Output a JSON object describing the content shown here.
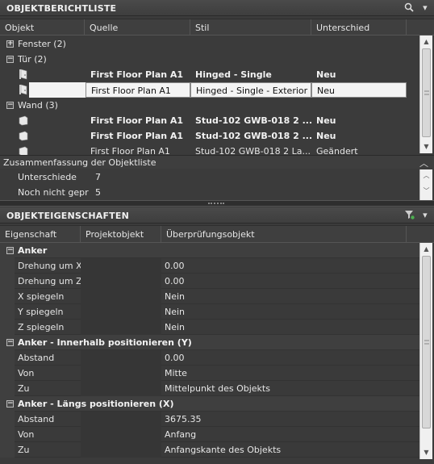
{
  "object_report": {
    "title": "OBJEKTBERICHTLISTE",
    "columns": [
      "Objekt",
      "Quelle",
      "Stil",
      "Unterschied"
    ],
    "groups": [
      {
        "label": "Fenster (2)",
        "expanded": false,
        "rows": []
      },
      {
        "label": "Tür (2)",
        "expanded": true,
        "rows": [
          {
            "quelle": "First Floor Plan A1",
            "stil": "Hinged - Single",
            "unterschied": "Neu",
            "bold": true,
            "selected": false,
            "icon": "door-icon"
          },
          {
            "quelle": "First Floor Plan A1",
            "stil": "Hinged - Single - Exterior",
            "unterschied": "Neu",
            "bold": false,
            "selected": true,
            "icon": "door-icon"
          }
        ]
      },
      {
        "label": "Wand (3)",
        "expanded": true,
        "rows": [
          {
            "quelle": "First Floor Plan A1",
            "stil": "Stud-102 GWB-018 2 ...",
            "unterschied": "Neu",
            "bold": true,
            "selected": false,
            "icon": "wall-icon"
          },
          {
            "quelle": "First Floor Plan A1",
            "stil": "Stud-102 GWB-018 2 ...",
            "unterschied": "Neu",
            "bold": true,
            "selected": false,
            "icon": "wall-icon"
          },
          {
            "quelle": "First Floor Plan A1",
            "stil": "Stud-102 GWB-018 2 La...",
            "unterschied": "Geändert",
            "bold": false,
            "selected": false,
            "icon": "wall-icon"
          }
        ]
      }
    ]
  },
  "summary": {
    "title": "Zusammenfassung der Objektliste",
    "items": [
      {
        "label": "Unterschiede",
        "value": "7"
      },
      {
        "label": "Noch nicht geprüft",
        "value": "5"
      }
    ]
  },
  "properties": {
    "title": "OBJEKTEIGENSCHAFTEN",
    "columns": [
      "Eigenschaft",
      "Projektobjekt",
      "Überprüfungsobjekt"
    ],
    "rows": [
      {
        "type": "category",
        "name": "Anker"
      },
      {
        "type": "prop",
        "name": "Drehung um X",
        "value": "0.00"
      },
      {
        "type": "prop",
        "name": "Drehung um Z",
        "value": "0.00"
      },
      {
        "type": "prop",
        "name": "X spiegeln",
        "value": "Nein"
      },
      {
        "type": "prop",
        "name": "Y spiegeln",
        "value": "Nein"
      },
      {
        "type": "prop",
        "name": "Z spiegeln",
        "value": "Nein"
      },
      {
        "type": "category",
        "name": "Anker - Innerhalb positionieren (Y)"
      },
      {
        "type": "prop",
        "name": "Abstand",
        "value": "0.00"
      },
      {
        "type": "prop",
        "name": "Von",
        "value": "Mitte"
      },
      {
        "type": "prop",
        "name": "Zu",
        "value": "Mittelpunkt des Objekts"
      },
      {
        "type": "category",
        "name": "Anker - Längs positionieren (X)"
      },
      {
        "type": "prop",
        "name": "Abstand",
        "value": "3675.35"
      },
      {
        "type": "prop",
        "name": "Von",
        "value": "Anfang"
      },
      {
        "type": "prop",
        "name": "Zu",
        "value": "Anfangskante des Objekts"
      }
    ]
  },
  "icons": {
    "zoom": "zoom-icon",
    "filter": "filter-icon",
    "collapse": "chevron-up-icon"
  }
}
